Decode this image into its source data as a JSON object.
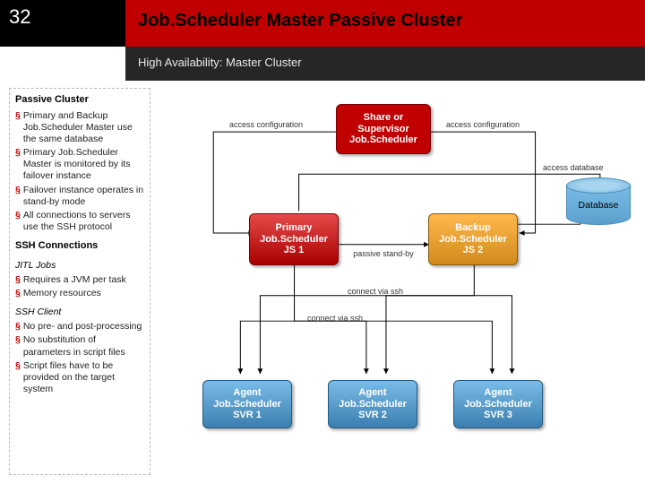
{
  "slide_number": "32",
  "title": "Job.Scheduler Master Passive Cluster",
  "subtitle": "High Availability: Master Cluster",
  "sidebar": {
    "heading": "Passive Cluster",
    "bullets1": [
      "Primary and Backup Job.Scheduler Master use the same database",
      "Primary Job.Scheduler Master is monitored by its failover instance",
      "Failover instance operates in stand-by mode",
      "All connections to servers use the SSH protocol"
    ],
    "heading2": "SSH Connections",
    "jitl_heading": "JITL Jobs",
    "jitl_bullets": [
      "Requires a JVM per task",
      "Memory resources"
    ],
    "ssh_heading": "SSH Client",
    "ssh_bullets": [
      "No pre- and post-processing",
      "No substitution of parameters in script files",
      "Script files have to be provided on the target system"
    ]
  },
  "diagram": {
    "supervisor": {
      "l1": "Share or",
      "l2": "Supervisor",
      "l3": "Job.Scheduler"
    },
    "primary": {
      "l1": "Primary",
      "l2": "Job.Scheduler",
      "l3": "JS 1"
    },
    "backup": {
      "l1": "Backup",
      "l2": "Job.Scheduler",
      "l3": "JS 2"
    },
    "agent1": {
      "l1": "Agent",
      "l2": "Job.Scheduler",
      "l3": "SVR 1"
    },
    "agent2": {
      "l1": "Agent",
      "l2": "Job.Scheduler",
      "l3": "SVR 2"
    },
    "agent3": {
      "l1": "Agent",
      "l2": "Job.Scheduler",
      "l3": "SVR 3"
    },
    "database": "Database",
    "labels": {
      "access_cfg_l": "access configuration",
      "access_cfg_r": "access configuration",
      "access_db": "access database",
      "standby": "passive stand-by",
      "ssh1": "connect via ssh",
      "ssh2": "connect via ssh"
    }
  }
}
